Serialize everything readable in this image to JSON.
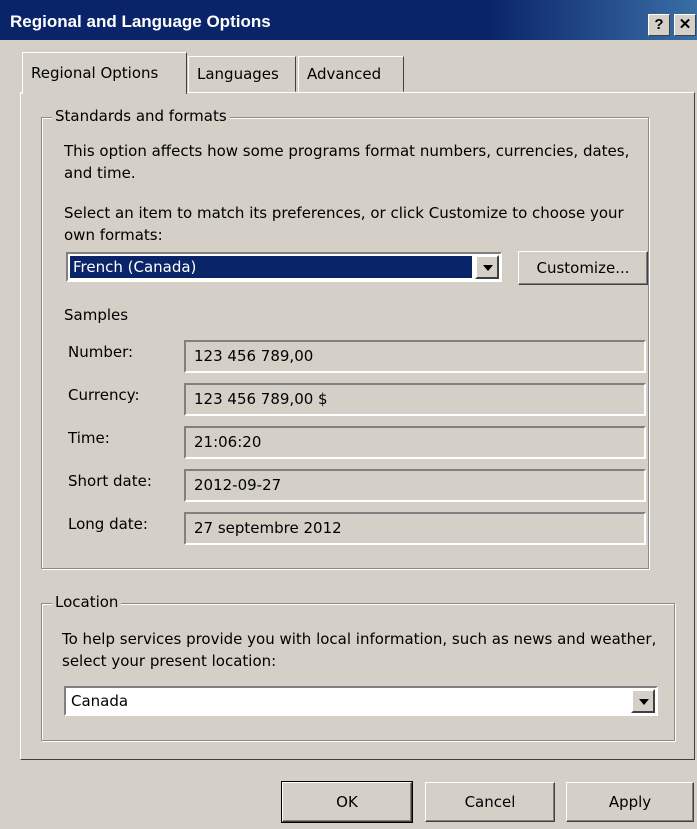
{
  "window": {
    "title": "Regional and Language Options",
    "help_glyph": "?",
    "close_glyph": "✕"
  },
  "tabs": [
    {
      "label": "Regional Options",
      "active": true
    },
    {
      "label": "Languages",
      "active": false
    },
    {
      "label": "Advanced",
      "active": false
    }
  ],
  "standards": {
    "legend": "Standards and formats",
    "description": "This option affects how some programs format numbers, currencies, dates, and time.",
    "select_prompt": "Select an item to match its preferences, or click Customize to choose your own formats:",
    "format_value": "French (Canada)",
    "customize_label": "Customize...",
    "samples_heading": "Samples",
    "samples": [
      {
        "label": "Number:",
        "value": "123 456 789,00"
      },
      {
        "label": "Currency:",
        "value": "123 456 789,00 $"
      },
      {
        "label": "Time:",
        "value": "21:06:20"
      },
      {
        "label": "Short date:",
        "value": "2012-09-27"
      },
      {
        "label": "Long date:",
        "value": "27 septembre 2012"
      }
    ]
  },
  "location": {
    "legend": "Location",
    "description": "To help services provide you with local information, such as news and weather, select your present location:",
    "value": "Canada"
  },
  "footer": {
    "ok_label": "OK",
    "cancel_label": "Cancel",
    "apply_label": "Apply"
  },
  "colors": {
    "title_bar": "#0a246a",
    "dialog_face": "#d4d0c8",
    "selection": "#0a246a"
  }
}
